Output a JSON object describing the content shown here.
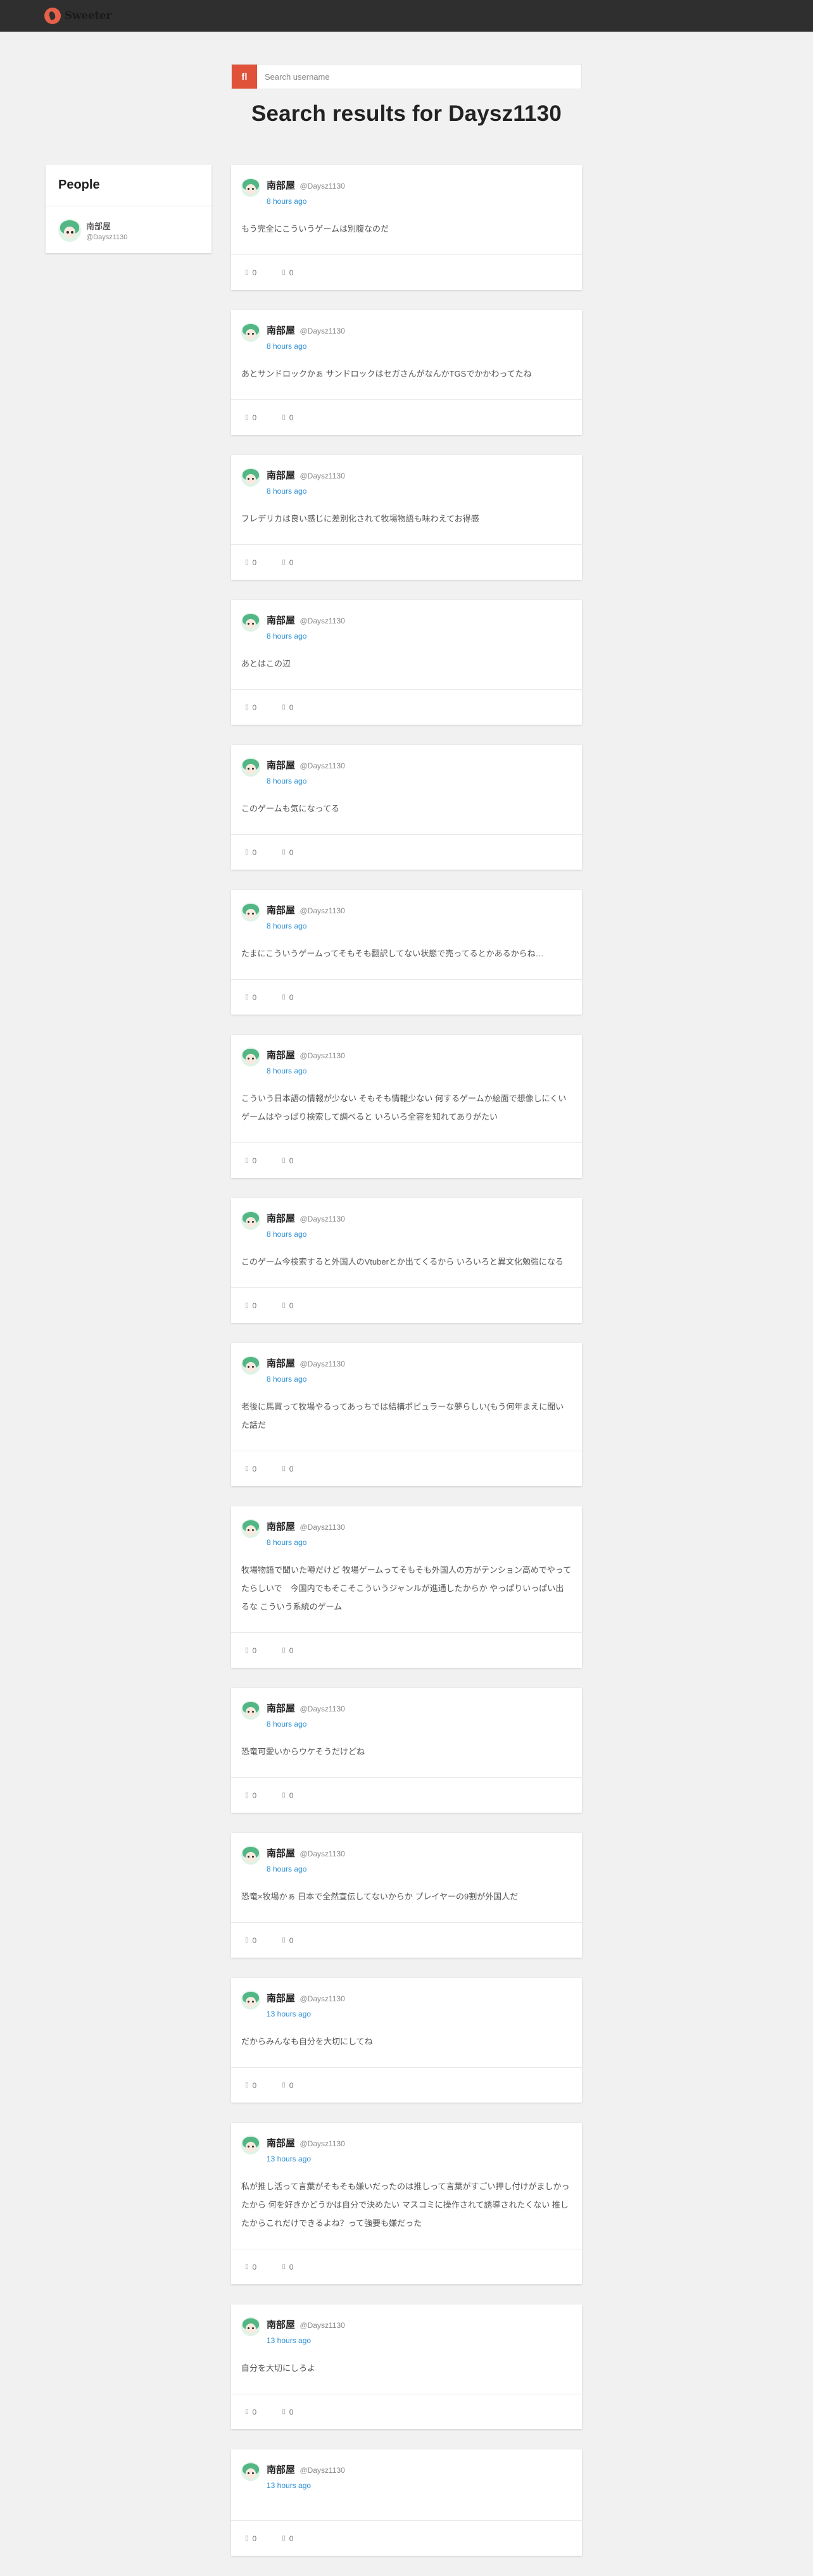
{
  "app": {
    "logo_text": "Sweeter",
    "accent": "#e0523a"
  },
  "search": {
    "placeholder": "Search username",
    "button_glyph": "fl"
  },
  "heading": "Search results for Daysz1130",
  "people": {
    "title": "People",
    "items": [
      {
        "name": "南部屋",
        "handle": "@Daysz1130"
      }
    ]
  },
  "posts": [
    {
      "name": "南部屋",
      "handle": "@Daysz1130",
      "time": "8 hours ago",
      "text": "もう完全にこういうゲームは別腹なのだ",
      "likes": "0",
      "reposts": "0"
    },
    {
      "name": "南部屋",
      "handle": "@Daysz1130",
      "time": "8 hours ago",
      "text": "あとサンドロックかぁ サンドロックはセガさんがなんかTGSでかかわってたね",
      "likes": "0",
      "reposts": "0"
    },
    {
      "name": "南部屋",
      "handle": "@Daysz1130",
      "time": "8 hours ago",
      "text": "フレデリカは良い感じに差別化されて牧場物語も味わえてお得感",
      "likes": "0",
      "reposts": "0"
    },
    {
      "name": "南部屋",
      "handle": "@Daysz1130",
      "time": "8 hours ago",
      "text": "あとはこの辺",
      "likes": "0",
      "reposts": "0"
    },
    {
      "name": "南部屋",
      "handle": "@Daysz1130",
      "time": "8 hours ago",
      "text": "このゲームも気になってる",
      "likes": "0",
      "reposts": "0"
    },
    {
      "name": "南部屋",
      "handle": "@Daysz1130",
      "time": "8 hours ago",
      "text": "たまにこういうゲームってそもそも翻訳してない状態で売ってるとかあるからね…",
      "likes": "0",
      "reposts": "0"
    },
    {
      "name": "南部屋",
      "handle": "@Daysz1130",
      "time": "8 hours ago",
      "text": "こういう日本語の情報が少ない そもそも情報少ない 何するゲームか絵面で想像しにくいゲームはやっぱり検索して調べると いろいろ全容を知れてありがたい",
      "likes": "0",
      "reposts": "0"
    },
    {
      "name": "南部屋",
      "handle": "@Daysz1130",
      "time": "8 hours ago",
      "text": "このゲーム今検索すると外国人のVtuberとか出てくるから いろいろと異文化勉強になる",
      "likes": "0",
      "reposts": "0"
    },
    {
      "name": "南部屋",
      "handle": "@Daysz1130",
      "time": "8 hours ago",
      "text": "老後に馬買って牧場やるってあっちでは結構ポピュラーな夢らしい(もう何年まえに聞いた話だ",
      "likes": "0",
      "reposts": "0"
    },
    {
      "name": "南部屋",
      "handle": "@Daysz1130",
      "time": "8 hours ago",
      "text": "牧場物語で聞いた噂だけど 牧場ゲームってそもそも外国人の方がテンション高めでやってたらしいで　今国内でもそこそこういうジャンルが進通したからか やっぱりいっぱい出るな こういう系統のゲーム",
      "likes": "0",
      "reposts": "0"
    },
    {
      "name": "南部屋",
      "handle": "@Daysz1130",
      "time": "8 hours ago",
      "text": "恐竜可愛いからウケそうだけどね",
      "likes": "0",
      "reposts": "0"
    },
    {
      "name": "南部屋",
      "handle": "@Daysz1130",
      "time": "8 hours ago",
      "text": "恐竜×牧場かぁ 日本で全然宣伝してないからか プレイヤーの9割が外国人だ",
      "likes": "0",
      "reposts": "0"
    },
    {
      "name": "南部屋",
      "handle": "@Daysz1130",
      "time": "13 hours ago",
      "text": "だからみんなも自分を大切にしてね",
      "likes": "0",
      "reposts": "0"
    },
    {
      "name": "南部屋",
      "handle": "@Daysz1130",
      "time": "13 hours ago",
      "text": "私が推し活って言葉がそもそも嫌いだったのは推しって言葉がすごい押し付けがましかったから 何を好きかどうかは自分で決めたい マスコミに操作されて誘導されたくない 推したからこれだけできるよね？って強要も嫌だった",
      "likes": "0",
      "reposts": "0"
    },
    {
      "name": "南部屋",
      "handle": "@Daysz1130",
      "time": "13 hours ago",
      "text": "自分を大切にしろよ",
      "likes": "0",
      "reposts": "0"
    },
    {
      "name": "南部屋",
      "handle": "@Daysz1130",
      "time": "13 hours ago",
      "text": "",
      "likes": "0",
      "reposts": "0"
    }
  ]
}
